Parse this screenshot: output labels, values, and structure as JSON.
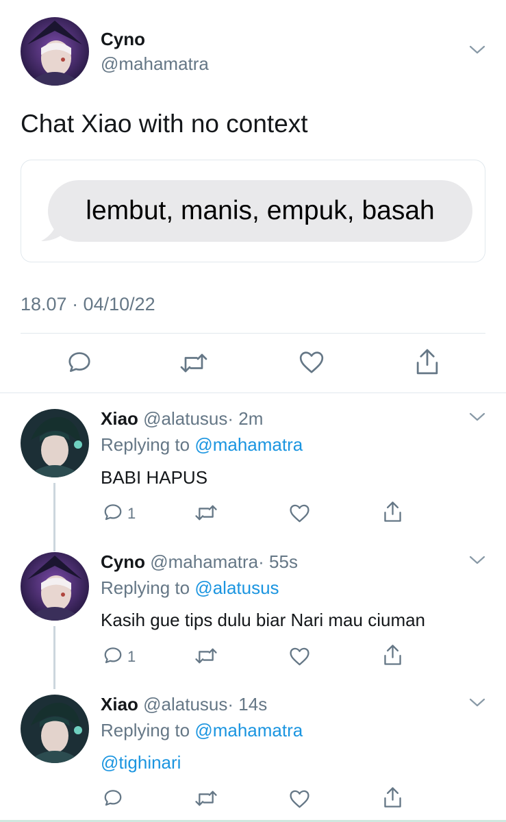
{
  "main_tweet": {
    "display_name": "Cyno",
    "handle": "@mahamatra",
    "text": "Chat Xiao with no context",
    "bubble_text": "lembut, manis, empuk, basah",
    "timestamp": "18.07 · 04/10/22"
  },
  "replies": [
    {
      "display_name": "Xiao",
      "handle": "@alatusus",
      "time": "· 2m",
      "replying_prefix": "Replying to",
      "replying_to": "@mahamatra",
      "text": "BABI HAPUS",
      "text_is_link": false,
      "reply_count": "1"
    },
    {
      "display_name": "Cyno",
      "handle": "@mahamatra",
      "time": "· 55s",
      "replying_prefix": "Replying to",
      "replying_to": "@alatusus",
      "text": "Kasih gue tips dulu biar Nari mau ciuman",
      "text_is_link": false,
      "reply_count": "1"
    },
    {
      "display_name": "Xiao",
      "handle": "@alatusus",
      "time": "· 14s",
      "replying_prefix": "Replying to",
      "replying_to": "@mahamatra",
      "text": "@tighinari",
      "text_is_link": true,
      "reply_count": ""
    }
  ],
  "icons": [
    "reply-icon",
    "retweet-icon",
    "like-icon",
    "share-icon",
    "chevron-down-icon"
  ],
  "colors": {
    "link": "#1b95e0",
    "muted": "#657786",
    "icon": "#657786",
    "bubble": "#e9e9eb"
  }
}
